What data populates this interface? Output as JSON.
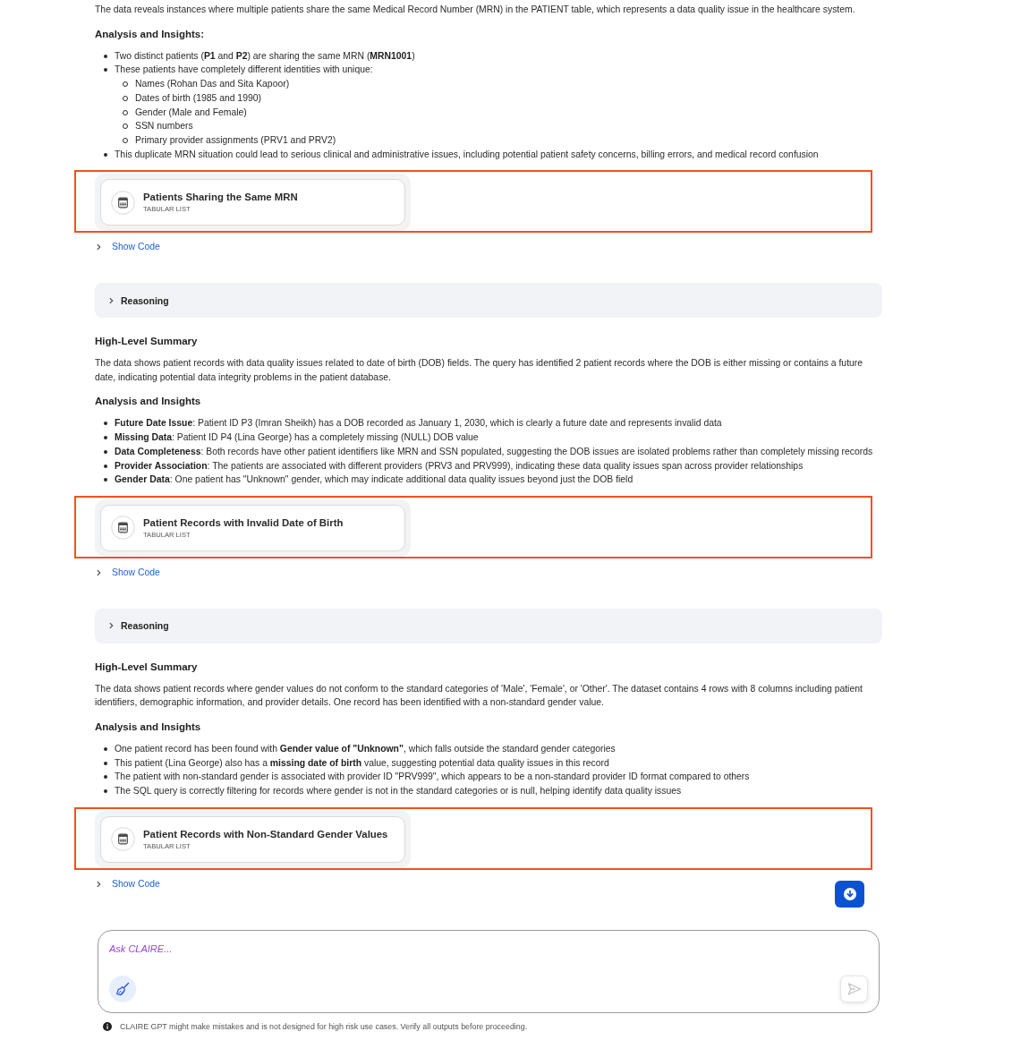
{
  "sections": [
    {
      "summary": "The data reveals instances where multiple patients share the same Medical Record Number (MRN) in the PATIENT table, which represents a data quality issue in the healthcare system.",
      "analysis_heading": "Analysis and Insights:",
      "insights": [
        {
          "text": "Two distinct patients (**P1** and **P2**) are sharing the same MRN (**MRN1001**)"
        },
        {
          "text": "These patients have completely different identities with unique:",
          "children": [
            {
              "text": "Names (Rohan Das and Sita Kapoor)"
            },
            {
              "text": "Dates of birth (1985 and 1990)"
            },
            {
              "text": "Gender (Male and Female)"
            },
            {
              "text": "SSN numbers"
            },
            {
              "text": "Primary provider assignments (PRV1 and PRV2)"
            }
          ]
        },
        {
          "text": "This duplicate MRN situation could lead to serious clinical and administrative issues, including potential patient safety concerns, billing errors, and medical record confusion"
        }
      ],
      "artifact": {
        "title": "Patients Sharing the Same MRN",
        "type_label": "TABULAR LIST",
        "highlighted": true
      },
      "show_code": {
        "label": "Show Code",
        "expanded": false
      }
    },
    {
      "reasoning": {
        "label": "Reasoning",
        "expanded": false
      },
      "summary_heading": "High-Level Summary",
      "summary": "The data shows patient records with data quality issues related to date of birth (DOB) fields. The query has identified 2 patient records where the DOB is either missing or contains a future date, indicating potential data integrity problems in the patient database.",
      "analysis_heading": "Analysis and Insights",
      "insights": [
        {
          "text": "**Future Date Issue**: Patient ID P3 (Imran Sheikh) has a DOB recorded as January 1, 2030, which is clearly a future date and represents invalid data"
        },
        {
          "text": "**Missing Data**: Patient ID P4 (Lina George) has a completely missing (NULL) DOB value"
        },
        {
          "text": "**Data Completeness**: Both records have other patient identifiers like MRN and SSN populated, suggesting the DOB issues are isolated problems rather than completely missing records"
        },
        {
          "text": "**Provider Association**: The patients are associated with different providers (PRV3 and PRV999), indicating these data quality issues span across provider relationships"
        },
        {
          "text": "**Gender Data**: One patient has \"Unknown\" gender, which may indicate additional data quality issues beyond just the DOB field"
        }
      ],
      "artifact": {
        "title": "Patient Records with Invalid Date of Birth",
        "type_label": "TABULAR LIST",
        "highlighted": true
      },
      "show_code": {
        "label": "Show Code",
        "expanded": false
      }
    },
    {
      "reasoning": {
        "label": "Reasoning",
        "expanded": false
      },
      "summary_heading": "High-Level Summary",
      "summary": "The data shows patient records where gender values do not conform to the standard categories of 'Male', 'Female', or 'Other'. The dataset contains 4 rows with 8 columns including patient identifiers, demographic information, and provider details. One record has been identified with a non-standard gender value.",
      "analysis_heading": "Analysis and Insights",
      "insights": [
        {
          "text": "One patient record has been found with **Gender value of \"Unknown\"**, which falls outside the standard gender categories"
        },
        {
          "text": "This patient (Lina George) also has a **missing date of birth** value, suggesting potential data quality issues in this record"
        },
        {
          "text": "The patient with non-standard gender is associated with provider ID \"PRV999\", which appears to be a non-standard provider ID format compared to others"
        },
        {
          "text": "The SQL query is correctly filtering for records where gender is not in the standard categories or is null, helping identify data quality issues"
        }
      ],
      "artifact": {
        "title": "Patient Records with Non-Standard Gender Values",
        "type_label": "TABULAR LIST",
        "highlighted": true
      },
      "show_code": {
        "label": "Show Code",
        "expanded": false
      }
    }
  ],
  "composer": {
    "placeholder": "Ask CLAIRE...",
    "send_disabled": true
  },
  "disclaimer": "CLAIRE GPT might make mistakes and is not designed for high risk use cases. Verify all outputs before proceeding."
}
